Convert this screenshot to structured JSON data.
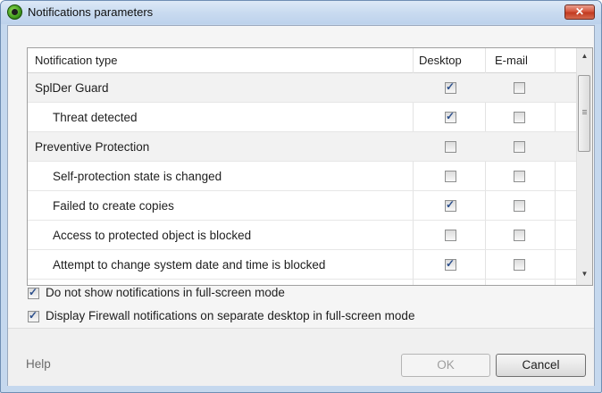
{
  "window": {
    "title": "Notifications parameters",
    "close_glyph": "✕",
    "app_icon": "spider-bug-icon",
    "colors": {
      "title_bar": "#c9dbf0",
      "close_button": "#c9462a",
      "checkbox_check": "#2c4f8c"
    }
  },
  "grid": {
    "columns": {
      "type": "Notification type",
      "desktop": "Desktop",
      "email": "E-mail"
    },
    "rows": [
      {
        "label": "SplDer Guard",
        "level": 0,
        "desktop": true,
        "email": false
      },
      {
        "label": "Threat detected",
        "level": 1,
        "desktop": true,
        "email": false
      },
      {
        "label": "Preventive Protection",
        "level": 0,
        "desktop": false,
        "email": false
      },
      {
        "label": "Self-protection state is changed",
        "level": 1,
        "desktop": false,
        "email": false
      },
      {
        "label": "Failed to create copies",
        "level": 1,
        "desktop": true,
        "email": false
      },
      {
        "label": "Access to protected object is blocked",
        "level": 1,
        "desktop": false,
        "email": false
      },
      {
        "label": "Attempt to change system date and time is blocked",
        "level": 1,
        "desktop": true,
        "email": false
      }
    ],
    "scrollbar": {
      "up_glyph": "▲",
      "down_glyph": "▼"
    }
  },
  "options": {
    "fullscreen_label": "Do not show notifications in full-screen mode",
    "fullscreen_checked": true,
    "firewall_label": "Display Firewall notifications on separate desktop in full-screen mode",
    "firewall_checked": true
  },
  "footer": {
    "help": "Help",
    "ok": "OK",
    "cancel": "Cancel"
  }
}
